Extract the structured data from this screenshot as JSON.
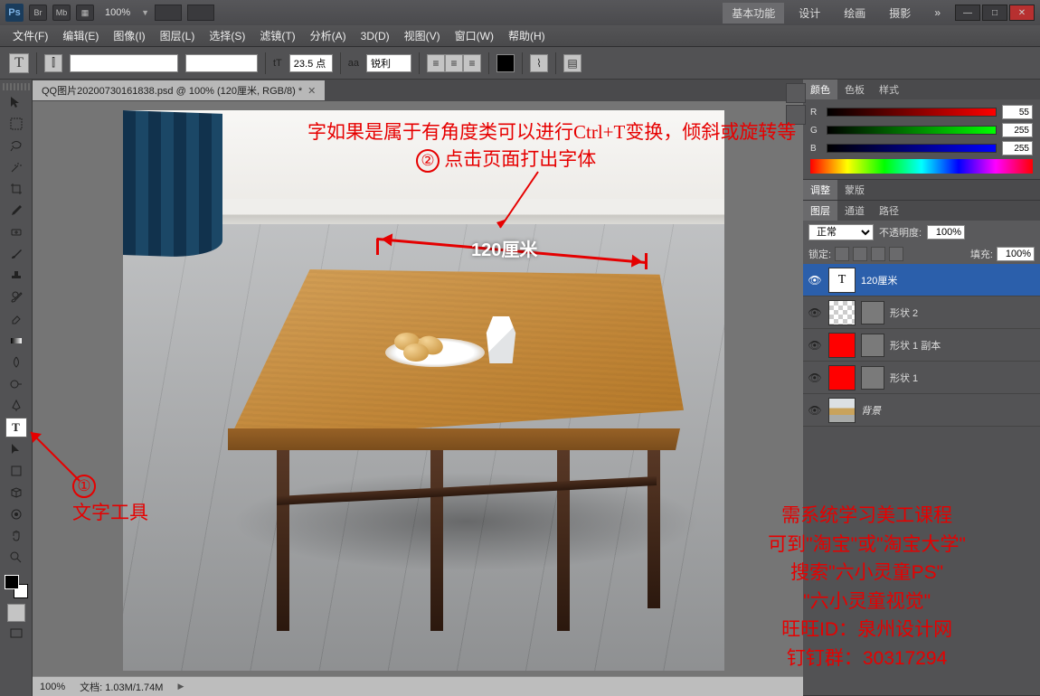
{
  "titlebar": {
    "ps": "Ps",
    "br": "Br",
    "mb": "Mb",
    "zoom": "100%",
    "workspace_active": "基本功能",
    "ws_design": "设计",
    "ws_paint": "绘画",
    "ws_photo": "摄影",
    "more": "»"
  },
  "menus": [
    "文件(F)",
    "编辑(E)",
    "图像(I)",
    "图层(L)",
    "选择(S)",
    "滤镜(T)",
    "分析(A)",
    "3D(D)",
    "视图(V)",
    "窗口(W)",
    "帮助(H)"
  ],
  "options": {
    "tool_letter": "T",
    "size_icon": "tT",
    "font_size": "23.5 点",
    "aa_label": "aa",
    "aa_mode": "锐利",
    "swap_icon": "⇄"
  },
  "document": {
    "tab_title": "QQ图片20200730161838.psd @ 100% (120厘米, RGB/8) *",
    "status_zoom": "100%",
    "status_doc": "文档: 1.03M/1.74M",
    "dimension_text": "120厘米"
  },
  "annotations": {
    "top_line": "字如果是属于有角度类可以进行Ctrl+T变换，倾斜或旋转等",
    "step2_num": "②",
    "step2_text": "点击页面打出字体",
    "step1_num": "①",
    "step1_text": "文字工具",
    "course": {
      "l1": "需系统学习美工课程",
      "l2": "可到\"淘宝\"或\"淘宝大学\"",
      "l3": "搜索\"六小灵童PS\"",
      "l4": "\"六小灵童视觉\"",
      "l5": "旺旺ID：泉州设计网",
      "l6": "钉钉群：30317294"
    }
  },
  "panels": {
    "color": {
      "tab1": "颜色",
      "tab2": "色板",
      "tab3": "样式",
      "r": "55",
      "g": "255",
      "b": "255"
    },
    "adjust": {
      "tab1": "调整",
      "tab2": "蒙版"
    },
    "layers": {
      "tab1": "图层",
      "tab2": "通道",
      "tab3": "路径",
      "blend": "正常",
      "opacity_label": "不透明度:",
      "opacity": "100%",
      "lock_label": "锁定:",
      "fill_label": "填充:",
      "fill": "100%",
      "items": [
        {
          "name": "120厘米",
          "type": "text"
        },
        {
          "name": "形状 2",
          "type": "shape-checker"
        },
        {
          "name": "形状 1 副本",
          "type": "shape-red"
        },
        {
          "name": "形状 1",
          "type": "shape-red"
        },
        {
          "name": "背景",
          "type": "bg",
          "italic": true
        }
      ]
    }
  }
}
